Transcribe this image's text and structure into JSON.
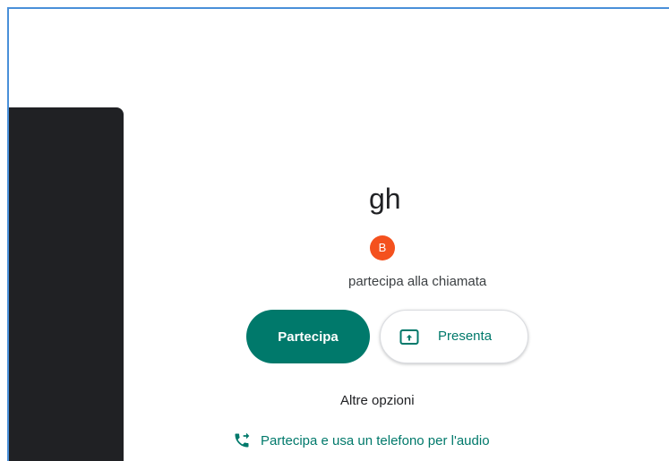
{
  "meeting": {
    "title": "gh",
    "participant_avatar_initial": "B",
    "participants_text": "partecipa alla chiamata"
  },
  "actions": {
    "join_label": "Partecipa",
    "present_label": "Presenta",
    "more_options_label": "Altre opzioni",
    "phone_audio_label": "Partecipa e usa un telefono per l'audio"
  },
  "icons": {
    "present": "present-screen-icon",
    "phone": "phone-forwarded-icon"
  },
  "colors": {
    "accent": "#00796b",
    "avatar": "#f4511e",
    "preview_background": "#202124",
    "frame_border": "#4a90d9"
  }
}
